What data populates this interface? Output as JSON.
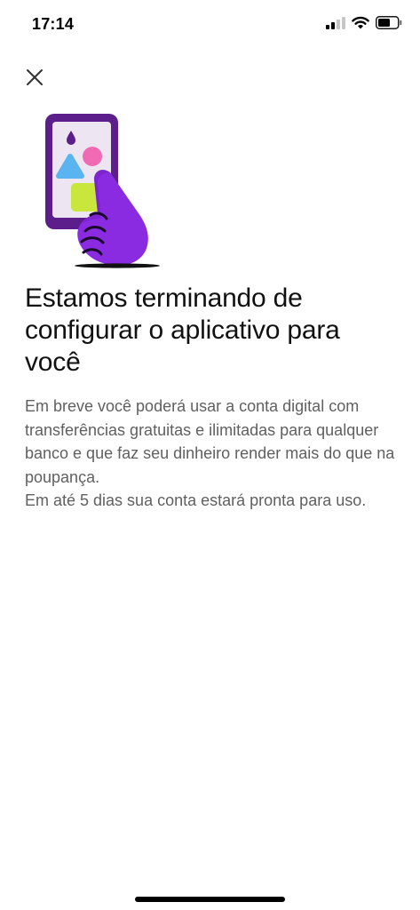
{
  "status_bar": {
    "time": "17:14",
    "icons": [
      "cellular-signal-icon",
      "wifi-icon",
      "battery-icon"
    ]
  },
  "header": {
    "close_icon": "close-icon"
  },
  "illustration": {
    "description_icon": "phone-tap-illustration",
    "colors": {
      "phone_frame": "#5b1e8a",
      "phone_screen": "#ede6f2",
      "hand": "#8a2be2",
      "drop": "#5b1e8a",
      "blue_triangle": "#5ab4f0",
      "pink_circle": "#f06ab4",
      "green_square": "#c8e63c"
    }
  },
  "content": {
    "title": "Estamos terminando de configurar o aplicativo para você",
    "paragraph_1": "Em breve você poderá usar a conta digital com transferências gratuitas e ilimitadas para qualquer banco e que faz seu dinheiro render mais do que na poupança.",
    "paragraph_2": "Em até 5 dias sua conta estará pronta para uso."
  }
}
